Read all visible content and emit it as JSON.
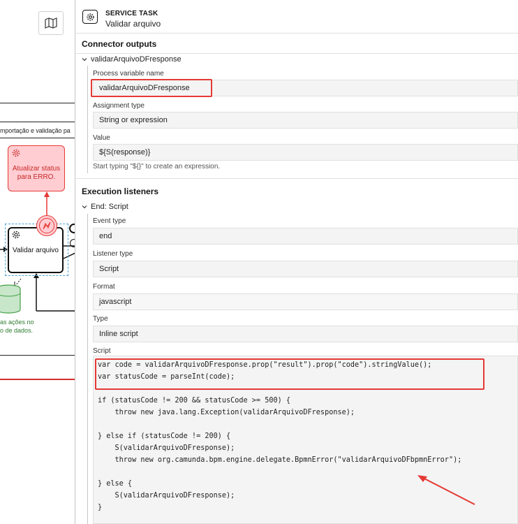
{
  "canvas": {
    "lane_label": "mportação e validação pa",
    "error_task_label": "Atualizar status para ERRO.",
    "main_task_label": "Validar arquivo",
    "datastore_label": "as ações no\no de dados."
  },
  "header": {
    "type": "SERVICE TASK",
    "name": "Validar arquivo"
  },
  "connector_outputs": {
    "title": "Connector outputs",
    "entry_title": "validarArquivoDFresponse",
    "process_variable_label": "Process variable name",
    "process_variable_value": "validarArquivoDFresponse",
    "assignment_type_label": "Assignment type",
    "assignment_type_value": "String or expression",
    "value_label": "Value",
    "value_value": "${S(response)}",
    "hint": "Start typing \"${}\" to create an expression."
  },
  "execution_listeners": {
    "title": "Execution listeners",
    "entry_title": "End: Script",
    "event_type_label": "Event type",
    "event_type_value": "end",
    "listener_type_label": "Listener type",
    "listener_type_value": "Script",
    "format_label": "Format",
    "format_value": "javascript",
    "type_label": "Type",
    "type_value": "Inline script",
    "script_label": "Script",
    "script_lines": [
      "var code = validarArquivoDFresponse.prop(\"result\").prop(\"code\").stringValue();",
      "var statusCode = parseInt(code);",
      "",
      "if (statusCode != 200 && statusCode >= 500) {",
      "    throw new java.lang.Exception(validarArquivoDFresponse);",
      "",
      "} else if (statusCode != 200) {",
      "    S(validarArquivoDFresponse);",
      "    throw new org.camunda.bpm.engine.delegate.BpmnError(\"validarArquivoDFbpmnError\");",
      "",
      "} else {",
      "    S(validarArquivoDFresponse);",
      "}"
    ]
  },
  "colors": {
    "annotation_red": "#e53935",
    "error_fill": "#ffcdd2",
    "datastore_green": "#2e7d32",
    "selection_blue": "#4fa3d1"
  },
  "icons": [
    "map-icon",
    "gear-icon",
    "chevron-down-icon",
    "error-bolt-icon",
    "database-icon"
  ]
}
